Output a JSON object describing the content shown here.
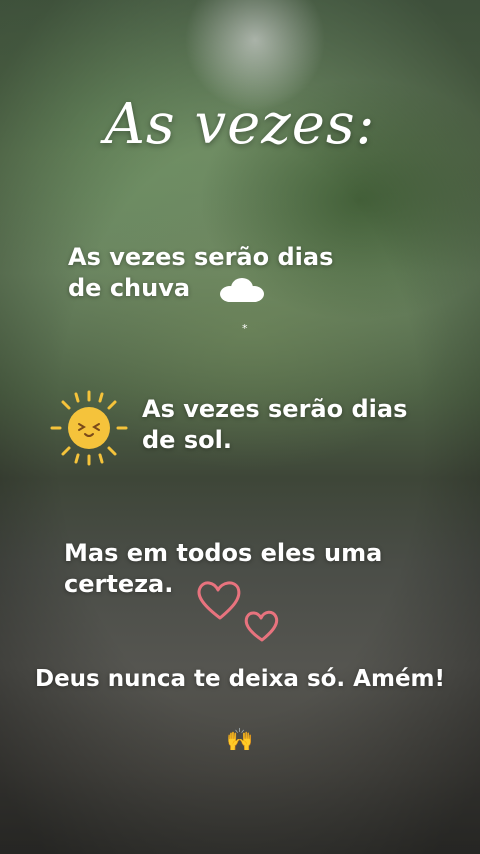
{
  "title": "As vezes:",
  "lines": {
    "rain": "As vezes serão dias de chuva",
    "sun": "As vezes serão dias de sol.",
    "certainty": "Mas em todos eles uma certeza.",
    "closing": "Deus nunca te deixa só. Amém!"
  },
  "emoji_hands": "🙌",
  "icons": [
    "cloud-icon",
    "sun-icon",
    "hearts-icon",
    "praise-hands-icon"
  ],
  "colors": {
    "text": "#ffffff",
    "sun": "#f5c33b",
    "hearts": "#e8737e"
  }
}
